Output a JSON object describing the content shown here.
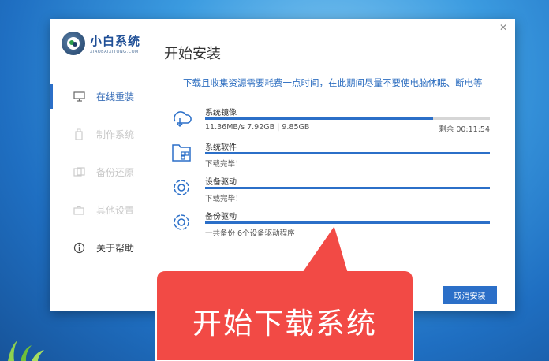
{
  "app": {
    "name": "小白系统",
    "subtitle": "XIAOBAIXITONG.COM"
  },
  "window_controls": {
    "minimize": "—",
    "close": "✕"
  },
  "page_title": "开始安装",
  "notice": "下载且收集资源需要耗费一点时间，在此期间尽量不要使电脑休眠、断电等",
  "nav": [
    {
      "label": "在线重装",
      "icon": "monitor-icon",
      "state": "active"
    },
    {
      "label": "制作系统",
      "icon": "usb-icon",
      "state": "disabled"
    },
    {
      "label": "备份还原",
      "icon": "backup-icon",
      "state": "disabled"
    },
    {
      "label": "其他设置",
      "icon": "settings-briefcase-icon",
      "state": "disabled"
    },
    {
      "label": "关于帮助",
      "icon": "info-icon",
      "state": "normal"
    }
  ],
  "tasks": [
    {
      "name": "系统镜像",
      "icon": "download-cloud-icon",
      "status": "11.36MB/s 7.92GB | 9.85GB",
      "remaining": "剩余 00:11:54",
      "progress": 0.8
    },
    {
      "name": "系统软件",
      "icon": "software-package-icon",
      "status": "下载完毕！",
      "progress": 1.0
    },
    {
      "name": "设备驱动",
      "icon": "gear-icon",
      "status": "下载完毕！",
      "progress": 1.0
    },
    {
      "name": "备份驱动",
      "icon": "gear-icon",
      "status": "一共备份 6个设备驱动程序",
      "progress": 1.0
    }
  ],
  "buttons": {
    "cancel": "取消安装",
    "partial_link": "系统"
  },
  "callout_text": "开始下载系统",
  "colors": {
    "accent": "#2b6fc8",
    "callout": "#f24a45"
  }
}
